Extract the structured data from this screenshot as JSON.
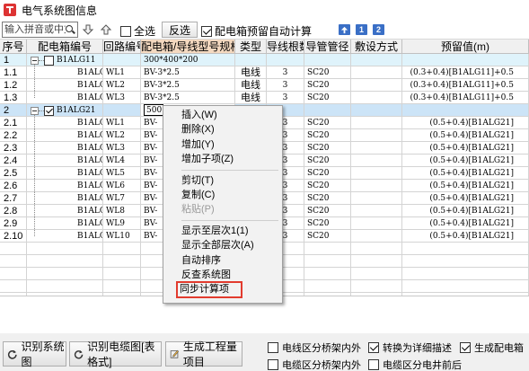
{
  "window": {
    "title": "电气系统图信息"
  },
  "toolbar": {
    "search_placeholder": "输入拼音或中文",
    "select_all_label": "全选",
    "invert_label": "反选",
    "auto_calc_label": "配电箱预留自动计算",
    "auto_calc_checked": true,
    "level_buttons": [
      "1",
      "2"
    ]
  },
  "columns": [
    "序号",
    "配电箱编号",
    "回路编号",
    "配电箱/导线型号规格",
    "类型",
    "导线根数",
    "导管管径",
    "敷设方式",
    "预留值(m)"
  ],
  "groups": [
    {
      "seq": "1",
      "box": "B1ALG11",
      "spec": "300*400*200",
      "checked": false,
      "rows": [
        {
          "seq": "1.1",
          "box": "B1ALG11",
          "loop": "WL1",
          "spec": "BV-3*2.5",
          "type": "电线",
          "count": "3",
          "pipe": "SC20",
          "lay": "",
          "reserve": "(0.3+0.4)[B1ALG11]+0.5"
        },
        {
          "seq": "1.2",
          "box": "B1ALG11",
          "loop": "WL2",
          "spec": "BV-3*2.5",
          "type": "电线",
          "count": "3",
          "pipe": "SC20",
          "lay": "",
          "reserve": "(0.3+0.4)[B1ALG11]+0.5"
        },
        {
          "seq": "1.3",
          "box": "B1ALG11",
          "loop": "WL3",
          "spec": "BV-3*2.5",
          "type": "电线",
          "count": "3",
          "pipe": "SC20",
          "lay": "",
          "reserve": "(0.3+0.4)[B1ALG11]+0.5"
        }
      ]
    },
    {
      "seq": "2",
      "box": "B1ALG21",
      "spec": "500",
      "checked": true,
      "rows": [
        {
          "seq": "2.1",
          "box": "B1ALG21",
          "loop": "WL1",
          "spec": "BV-",
          "type": "",
          "count": "3",
          "pipe": "SC20",
          "lay": "",
          "reserve": "(0.5+0.4)[B1ALG21]"
        },
        {
          "seq": "2.2",
          "box": "B1ALG21",
          "loop": "WL2",
          "spec": "BV-",
          "type": "",
          "count": "3",
          "pipe": "SC20",
          "lay": "",
          "reserve": "(0.5+0.4)[B1ALG21]"
        },
        {
          "seq": "2.3",
          "box": "B1ALG21",
          "loop": "WL3",
          "spec": "BV-",
          "type": "",
          "count": "3",
          "pipe": "SC20",
          "lay": "",
          "reserve": "(0.5+0.4)[B1ALG21]"
        },
        {
          "seq": "2.4",
          "box": "B1ALG21",
          "loop": "WL4",
          "spec": "BV-",
          "type": "",
          "count": "3",
          "pipe": "SC20",
          "lay": "",
          "reserve": "(0.5+0.4)[B1ALG21]"
        },
        {
          "seq": "2.5",
          "box": "B1ALG21",
          "loop": "WL5",
          "spec": "BV-",
          "type": "",
          "count": "3",
          "pipe": "SC20",
          "lay": "",
          "reserve": "(0.5+0.4)[B1ALG21]"
        },
        {
          "seq": "2.6",
          "box": "B1ALG21",
          "loop": "WL6",
          "spec": "BV-",
          "type": "",
          "count": "3",
          "pipe": "SC20",
          "lay": "",
          "reserve": "(0.5+0.4)[B1ALG21]"
        },
        {
          "seq": "2.7",
          "box": "B1ALG21",
          "loop": "WL7",
          "spec": "BV-",
          "type": "",
          "count": "3",
          "pipe": "SC20",
          "lay": "",
          "reserve": "(0.5+0.4)[B1ALG21]"
        },
        {
          "seq": "2.8",
          "box": "B1ALG21",
          "loop": "WL8",
          "spec": "BV-",
          "type": "",
          "count": "3",
          "pipe": "SC20",
          "lay": "",
          "reserve": "(0.5+0.4)[B1ALG21]"
        },
        {
          "seq": "2.9",
          "box": "B1ALG21",
          "loop": "WL9",
          "spec": "BV-",
          "type": "",
          "count": "3",
          "pipe": "SC20",
          "lay": "",
          "reserve": "(0.5+0.4)[B1ALG21]"
        },
        {
          "seq": "2.10",
          "box": "B1ALG21",
          "loop": "WL10",
          "spec": "BV-",
          "type": "",
          "count": "3",
          "pipe": "SC20",
          "lay": "",
          "reserve": "(0.5+0.4)[B1ALG21]"
        }
      ]
    }
  ],
  "context_menu": [
    {
      "label": "插入(W)",
      "disabled": false
    },
    {
      "label": "删除(X)",
      "disabled": false
    },
    {
      "label": "增加(Y)",
      "disabled": false
    },
    {
      "label": "增加子项(Z)",
      "disabled": false
    },
    {
      "separator": true
    },
    {
      "label": "剪切(T)",
      "disabled": false
    },
    {
      "label": "复制(C)",
      "disabled": false
    },
    {
      "label": "粘贴(P)",
      "disabled": true
    },
    {
      "separator": true
    },
    {
      "label": "显示至层次1(1)",
      "disabled": false
    },
    {
      "label": "显示全部层次(A)",
      "disabled": false
    },
    {
      "label": "自动排序",
      "disabled": false
    },
    {
      "label": "反查系统图",
      "disabled": false
    },
    {
      "label": "同步计算项",
      "disabled": false,
      "highlighted": true
    }
  ],
  "bottom": {
    "btn_identify_system": "识别系统图",
    "btn_identify_cable": "识别电缆图[表格式]",
    "btn_generate": "生成工程量项目",
    "options": [
      {
        "label": "电线区分桥架内外",
        "checked": false
      },
      {
        "label": "转换为详细描述",
        "checked": true
      },
      {
        "label": "生成配电箱",
        "checked": true
      },
      {
        "label": "电缆区分桥架内外",
        "checked": false
      },
      {
        "label": "电缆区分电井前后",
        "checked": false
      }
    ]
  },
  "colors": {
    "group_row_bg": "#dff3fb",
    "selected_row_bg": "#cce4f7",
    "header_highlight": "#f4d9c0",
    "menu_highlight_border": "#e23b2e"
  }
}
